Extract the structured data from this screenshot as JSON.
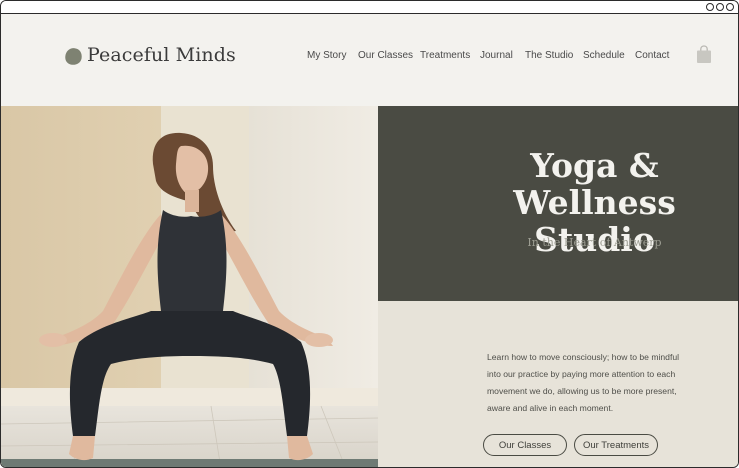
{
  "site": {
    "logo_text": "Peaceful Minds"
  },
  "nav": {
    "items": [
      "My Story",
      "Our Classes",
      "Treatments",
      "Journal",
      "The Studio",
      "Schedule",
      "Contact"
    ]
  },
  "hero": {
    "title_line1": "Yoga & Wellness",
    "title_line2": "Studio",
    "subtitle": "In the Heart of Antwerp",
    "intro": "Learn how to move consciously; how to be mindful into our practice by paying more attention to each movement we do, allowing us to be more present, aware and alive in each moment.",
    "button_classes": "Our Classes",
    "button_treatments": "Our Treatments"
  },
  "icons": {
    "logo": "pebble-logo-icon",
    "cart": "shopping-bag-icon",
    "window_controls": [
      "window-dot-icon",
      "window-dot-icon",
      "window-dot-icon"
    ]
  },
  "colors": {
    "header_bg": "#f3f2ee",
    "hero_dark": "#4a4b43",
    "hero_light": "#e7e3d9",
    "logo_pebble": "#7e8272"
  }
}
